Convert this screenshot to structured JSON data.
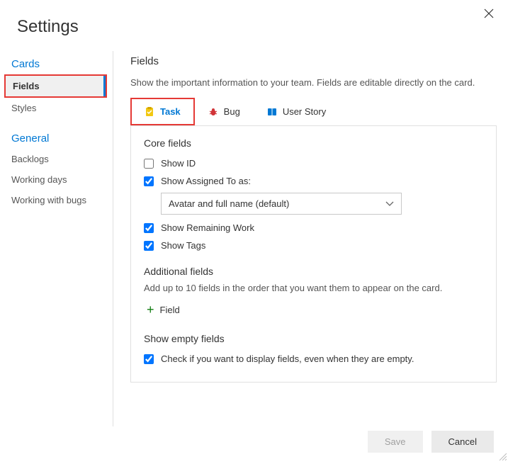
{
  "header": {
    "title": "Settings"
  },
  "sidebar": {
    "group1": {
      "title": "Cards",
      "items": [
        "Fields",
        "Styles"
      ],
      "activeIndex": 0
    },
    "group2": {
      "title": "General",
      "items": [
        "Backlogs",
        "Working days",
        "Working with bugs"
      ]
    }
  },
  "main": {
    "title": "Fields",
    "description": "Show the important information to your team. Fields are editable directly on the card.",
    "tabs": [
      {
        "label": "Task"
      },
      {
        "label": "Bug"
      },
      {
        "label": "User Story"
      }
    ],
    "core": {
      "header": "Core fields",
      "showId": {
        "label": "Show ID",
        "checked": false
      },
      "showAssigned": {
        "label": "Show Assigned To as:",
        "checked": true,
        "selectValue": "Avatar and full name (default)"
      },
      "showRemaining": {
        "label": "Show Remaining Work",
        "checked": true
      },
      "showTags": {
        "label": "Show Tags",
        "checked": true
      }
    },
    "additional": {
      "header": "Additional fields",
      "description": "Add up to 10 fields in the order that you want them to appear on the card.",
      "addLabel": "Field"
    },
    "empty": {
      "header": "Show empty fields",
      "label": "Check if you want to display fields, even when they are empty.",
      "checked": true
    }
  },
  "footer": {
    "save": "Save",
    "cancel": "Cancel"
  }
}
